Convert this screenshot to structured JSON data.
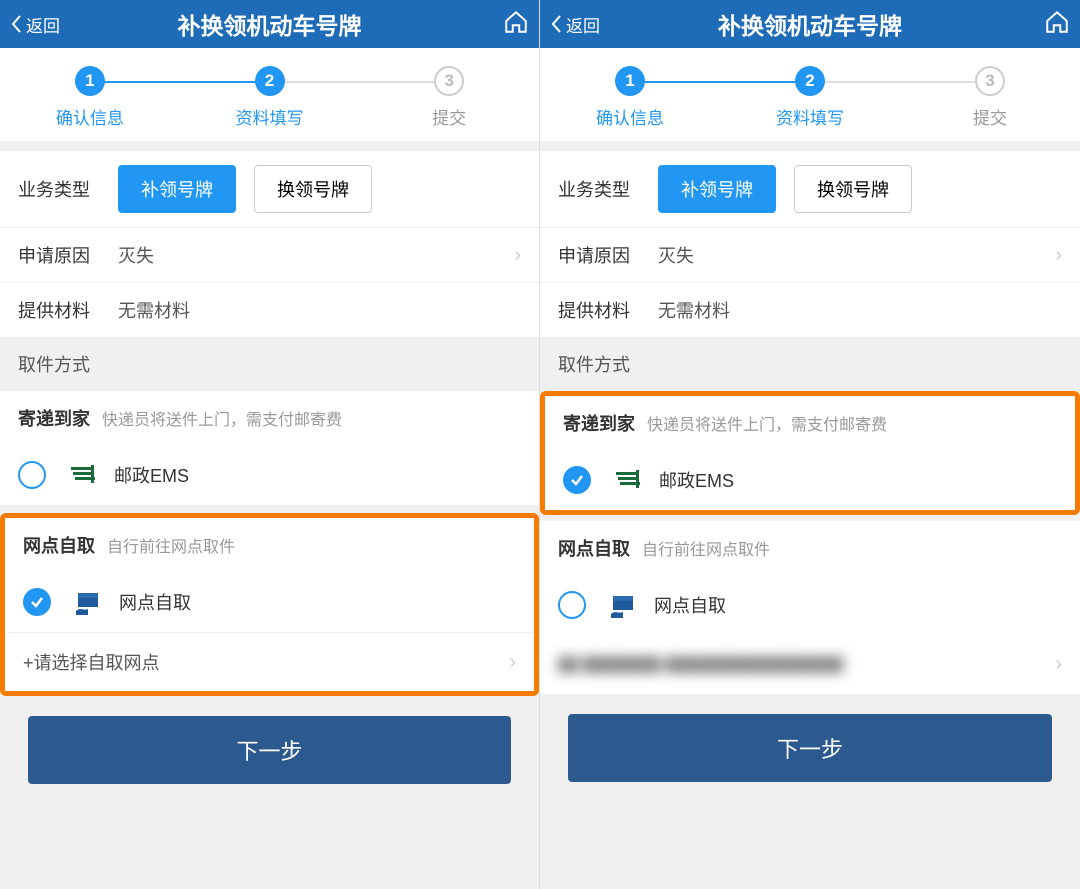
{
  "header": {
    "back": "返回",
    "title": "补换领机动车号牌"
  },
  "steps": {
    "s1": {
      "num": "1",
      "label": "确认信息"
    },
    "s2": {
      "num": "2",
      "label": "资料填写"
    },
    "s3": {
      "num": "3",
      "label": "提交"
    }
  },
  "business": {
    "label": "业务类型",
    "opt1": "补领号牌",
    "opt2": "换领号牌"
  },
  "reason": {
    "label": "申请原因",
    "value": "灭失"
  },
  "materials": {
    "label": "提供材料",
    "value": "无需材料"
  },
  "pickup_mode_label": "取件方式",
  "delivery": {
    "title": "寄递到家",
    "sub": "快递员将送件上门，需支付邮寄费",
    "ems": "邮政EMS"
  },
  "selfpickup": {
    "title": "网点自取",
    "sub": "自行前往网点取件",
    "opt": "网点自取",
    "select_hint": "+请选择自取网点"
  },
  "next": "下一步",
  "blurred_placeholder": "██ ████████\n██████████████████"
}
